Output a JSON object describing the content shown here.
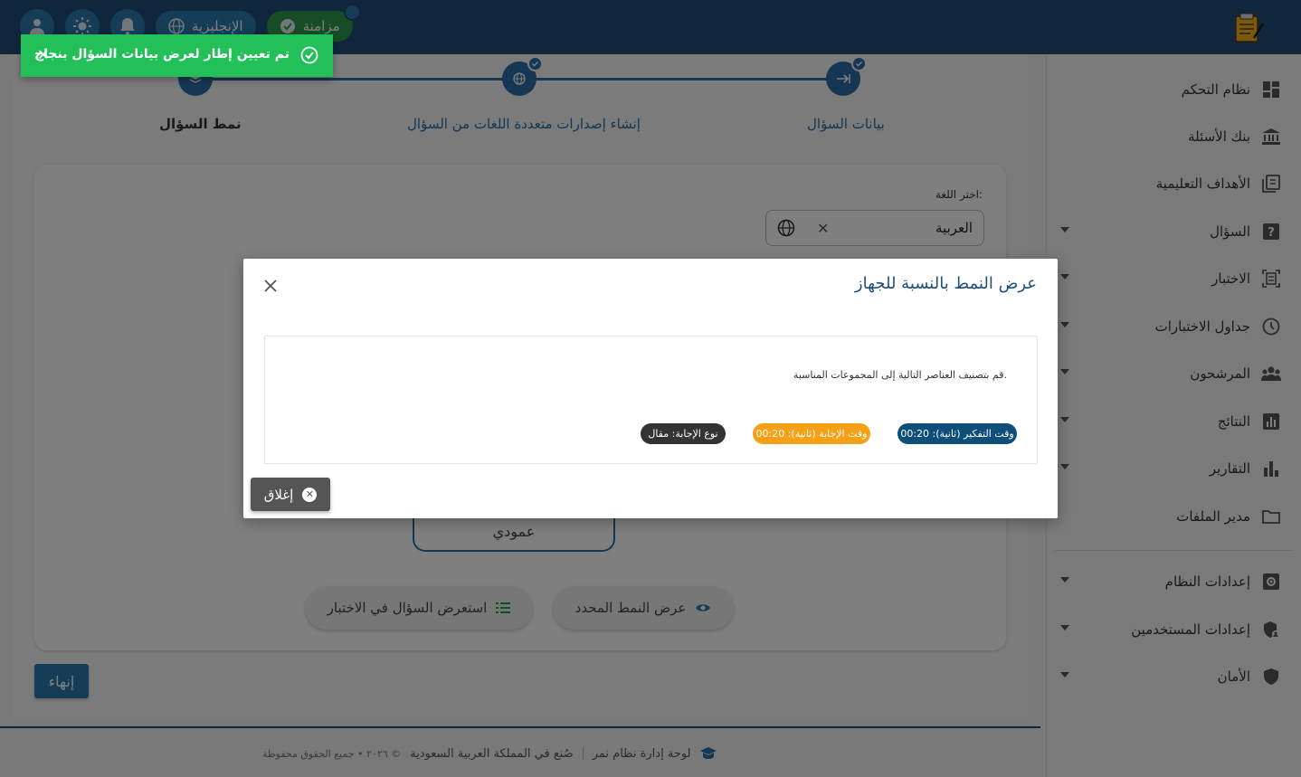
{
  "header": {
    "sync_label": "مزامنة",
    "language_label": "الإنجليزية"
  },
  "sidebar": {
    "items": [
      {
        "label": "نظام التحكم",
        "icon": "dashboard-icon",
        "expandable": false
      },
      {
        "label": "بنك الأسئلة",
        "icon": "bank-icon",
        "expandable": false
      },
      {
        "label": "الأهداف التعليمية",
        "icon": "book-icon",
        "expandable": false
      },
      {
        "label": "السؤال",
        "icon": "question-icon",
        "expandable": true
      },
      {
        "label": "الاختبار",
        "icon": "exam-icon",
        "expandable": true
      },
      {
        "label": "جداول الاختبارات",
        "icon": "clock-icon",
        "expandable": true
      },
      {
        "label": "المرشحون",
        "icon": "people-icon",
        "expandable": true
      },
      {
        "label": "النتائج",
        "icon": "results-icon",
        "expandable": true
      },
      {
        "label": "التقارير",
        "icon": "reports-icon",
        "expandable": true
      },
      {
        "label": "مدير الملفات",
        "icon": "folder-icon",
        "expandable": false
      },
      {
        "label": "إعدادات النظام",
        "icon": "settings-icon",
        "expandable": true
      },
      {
        "label": "إعدادات المستخدمين",
        "icon": "user-shield-icon",
        "expandable": true
      },
      {
        "label": "الأمان",
        "icon": "shield-icon",
        "expandable": true
      }
    ]
  },
  "stepper": {
    "steps": [
      {
        "label": "بيانات السؤال",
        "completed": true
      },
      {
        "label": "إنشاء إصدارات متعددة اللغات من السؤال",
        "completed": true
      },
      {
        "label": "نمط السؤال",
        "completed": false
      }
    ]
  },
  "form": {
    "language_label": "اختر اللغة:",
    "language_value": "العربية",
    "vertical_option": "عمودي",
    "show_pattern_button": "عرض النمط المحدد",
    "preview_button": "استعرض السؤال في الاختبار",
    "finish_button": "إنهاء"
  },
  "modal": {
    "title": "عرض النمط بالنسبة للجهاز",
    "instruction": "قم بتصنيف العناصر التالية إلى المجموعات المناسبة.",
    "chips": [
      {
        "label": "وقت التفكير (ثانية): 00:20",
        "color": "#0d4f7a"
      },
      {
        "label": "وقت الإجابة (ثانية): 00:20",
        "color": "#f5a015"
      },
      {
        "label": "نوع الإجابة: مقال",
        "color": "#333333"
      }
    ],
    "close_button": "إغلاق"
  },
  "toast": {
    "message": "تم تعيين إطار لعرض بيانات السؤال بنجاح"
  },
  "footer": {
    "brand": "لوحة إدارة نظام نمر",
    "made_in": "صُنع في المملكة العربية السعودية",
    "copyright": "© ٢٠٢٦ • جميع الحقوق محفوظة"
  }
}
